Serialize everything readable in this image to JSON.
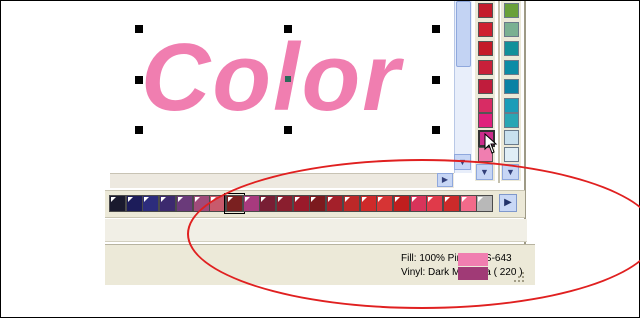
{
  "document": {
    "word": "Color",
    "fill_color": "#f07eb0"
  },
  "status": {
    "fill_text": "Fill: 100% Pink GCS-643",
    "vinyl_text": "Vinyl: Dark Magenta ( 220 )",
    "fill_swatch": "#f07eb0",
    "vinyl_swatch": "#a03a76"
  },
  "palette_column_1": [
    "#c41c2c",
    "#ce2030",
    "#c41a28",
    "#c8203a",
    "#c01c3c",
    "#d82c64",
    "#e0207c",
    "#cc2c8c",
    "#f07eb0",
    "#b86a2e"
  ],
  "palette_column_2": [
    "#6aa03a",
    "#7ab092",
    "#12909a",
    "#0c8ca6",
    "#0a82a4",
    "#1a9cb8",
    "#2aa6b4",
    "#c8e0ee",
    "#e0eef6",
    "#f2f8fa",
    "#ffffff"
  ],
  "swatch_row": [
    "#1a1a2e",
    "#1c1c5a",
    "#2c2c7c",
    "#3c2a6e",
    "#6a3a7a",
    "#a04a7a",
    "#c85a6c",
    "#7a2020",
    "#a83a7e",
    "#781e34",
    "#8a1e2e",
    "#9a1a2a",
    "#7c1a1e",
    "#a4202a",
    "#bc2828",
    "#ce2a2a",
    "#d63434",
    "#c01e1e",
    "#d8345a",
    "#e03a4a",
    "#cc2a2a",
    "#f26a8a",
    "#b8b8b8"
  ],
  "selected_swatch_index": 7,
  "icons": {
    "scroll_down": "chevron-down-icon",
    "scroll_right": "chevron-right-icon",
    "cursor": "mouse-pointer-icon",
    "resize": "resize-grip-icon"
  },
  "annotation": {
    "color": "#e02020"
  }
}
